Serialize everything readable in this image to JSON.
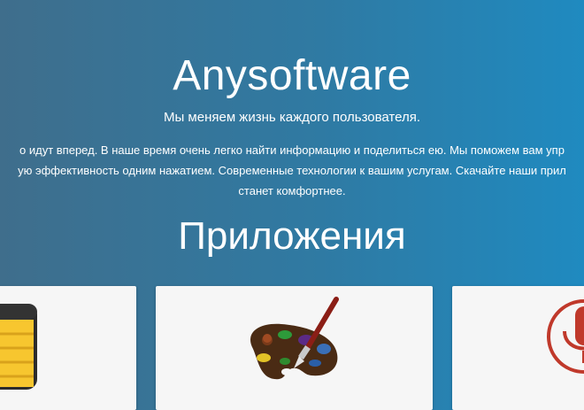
{
  "hero": {
    "brand": "Anysoftware",
    "tagline": "Мы меняем жизнь каждого пользователя.",
    "description_lines": [
      "о идут вперед. В наше время очень легко найти информацию и поделиться ею. Мы поможем вам упр",
      "ую эффективность одним нажатием. Современные технологии к вашим услугам. Скачайте наши прил",
      "станет комфортнее."
    ]
  },
  "apps": {
    "title": "Приложения",
    "cards": [
      {
        "icon": "notes-icon"
      },
      {
        "icon": "palette-icon"
      },
      {
        "icon": "microphone-icon"
      }
    ]
  },
  "colors": {
    "bg_left": "#3f6e8c",
    "bg_right": "#1f8ac0",
    "card": "#f6f6f6",
    "mic_red": "#c0392b"
  }
}
